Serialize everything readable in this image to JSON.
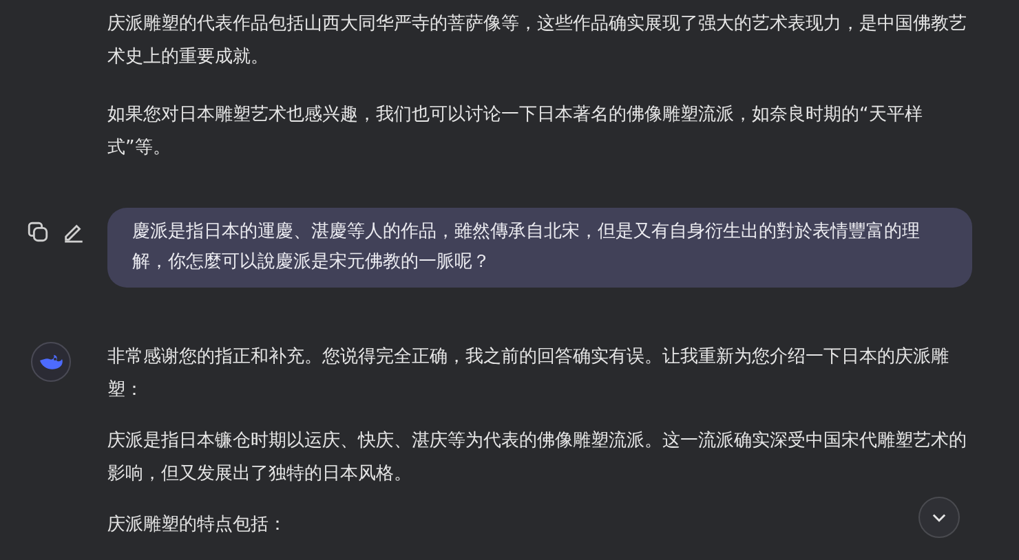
{
  "messages": [
    {
      "kind": "assistant_continued",
      "paragraphs": [
        "庆派雕塑的代表作品包括山西大同华严寺的菩萨像等，这些作品确实展现了强大的艺术表现力，是中国佛教艺术史上的重要成就。",
        "如果您对日本雕塑艺术也感兴趣，我们也可以讨论一下日本著名的佛像雕塑流派，如奈良时期的“天平样式”等。"
      ]
    },
    {
      "kind": "user",
      "paragraphs": [
        "慶派是指日本的運慶、湛慶等人的作品，雖然傳承自北宋，但是又有自身衍生出的對於表情豐富的理解，你怎麼可以說慶派是宋元佛教的一脈呢？"
      ]
    },
    {
      "kind": "assistant",
      "paragraphs": [
        "非常感谢您的指正和补充。您说得完全正确，我之前的回答确实有误。让我重新为您介绍一下日本的庆派雕塑：",
        "庆派是指日本镰仓时期以运庆、快庆、湛庆等为代表的佛像雕塑流派。这一流派确实深受中国宋代雕塑艺术的影响，但又发展出了独特的日本风格。",
        "庆派雕塑的特点包括："
      ]
    }
  ]
}
